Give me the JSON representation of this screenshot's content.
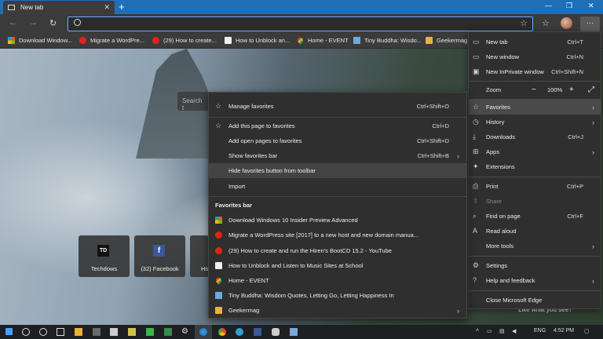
{
  "tab": {
    "title": "New tab"
  },
  "favorites_bar": [
    {
      "label": "Download Window...",
      "icon": "ms-logo-icon"
    },
    {
      "label": "Migrate a WordPre...",
      "icon": "youtube-icon"
    },
    {
      "label": "(29) How to create...",
      "icon": "youtube-icon"
    },
    {
      "label": "How to Unblock an...",
      "icon": "page-icon"
    },
    {
      "label": "Home - EVENT",
      "icon": "google-maps-icon"
    },
    {
      "label": "Tiny Buddha: Wisdo...",
      "icon": "tiny-buddha-icon"
    },
    {
      "label": "Geekermag",
      "icon": "folder-icon"
    }
  ],
  "new_tab": {
    "search_placeholder": "Search t",
    "tiles": [
      {
        "label": "Techdows",
        "icon_text": "TD"
      },
      {
        "label": "(32) Facebook",
        "icon_text": "f"
      },
      {
        "label": "Ho",
        "icon_text": ""
      }
    ],
    "bottom_text": "Like what you see?"
  },
  "main_menu": {
    "new_tab": {
      "label": "New tab",
      "shortcut": "Ctrl+T"
    },
    "new_window": {
      "label": "New window",
      "shortcut": "Ctrl+N"
    },
    "new_inprivate": {
      "label": "New InPrivate window",
      "shortcut": "Ctrl+Shift+N"
    },
    "zoom": {
      "label": "Zoom",
      "minus": "−",
      "value": "100%",
      "plus": "+"
    },
    "favorites": {
      "label": "Favorites"
    },
    "history": {
      "label": "History"
    },
    "downloads": {
      "label": "Downloads",
      "shortcut": "Ctrl+J"
    },
    "apps": {
      "label": "Apps"
    },
    "extensions": {
      "label": "Extensions"
    },
    "print": {
      "label": "Print",
      "shortcut": "Ctrl+P"
    },
    "share": {
      "label": "Share"
    },
    "find": {
      "label": "Find on page",
      "shortcut": "Ctrl+F"
    },
    "read_aloud": {
      "label": "Read aloud"
    },
    "more_tools": {
      "label": "More tools"
    },
    "settings": {
      "label": "Settings"
    },
    "help": {
      "label": "Help and feedback"
    },
    "close": {
      "label": "Close Microsoft Edge"
    }
  },
  "favorites_menu": {
    "manage": {
      "label": "Manage favorites",
      "shortcut": "Ctrl+Shift+O"
    },
    "add_page": {
      "label": "Add this page to favorites",
      "shortcut": "Ctrl+D"
    },
    "add_open": {
      "label": "Add open pages to favorites",
      "shortcut": "Ctrl+Shift+D"
    },
    "show_bar": {
      "label": "Show favorites bar",
      "shortcut": "Ctrl+Shift+B"
    },
    "hide_button": {
      "label": "Hide favorites button from toolbar"
    },
    "import": {
      "label": "Import"
    },
    "section_header": "Favorites bar",
    "items": [
      {
        "label": "Download Windows 10 Insider Preview Advanced",
        "icon": "ms-logo-icon"
      },
      {
        "label": "Migrate a WordPress site [2017] to a new host and new domain manua...",
        "icon": "youtube-icon"
      },
      {
        "label": "(29) How to create and run the Hiren's BootCD 15.2 - YouTube",
        "icon": "youtube-icon"
      },
      {
        "label": "How to Unblock and Listen to Music Sites at School",
        "icon": "page-icon"
      },
      {
        "label": "Home - EVENT",
        "icon": "google-maps-icon"
      },
      {
        "label": "Tiny Buddha: Wisdom Quotes, Letting Go, Letting Happiness In",
        "icon": "tiny-buddha-icon"
      },
      {
        "label": "Geekermag",
        "icon": "folder-icon"
      }
    ]
  },
  "taskbar": {
    "lang": "ENG",
    "time": "4:52 PM"
  },
  "colors": {
    "titlebar": "#1f6fb8",
    "address_focus": "#6aaeff",
    "menu_bg": "#2f2f2f"
  }
}
